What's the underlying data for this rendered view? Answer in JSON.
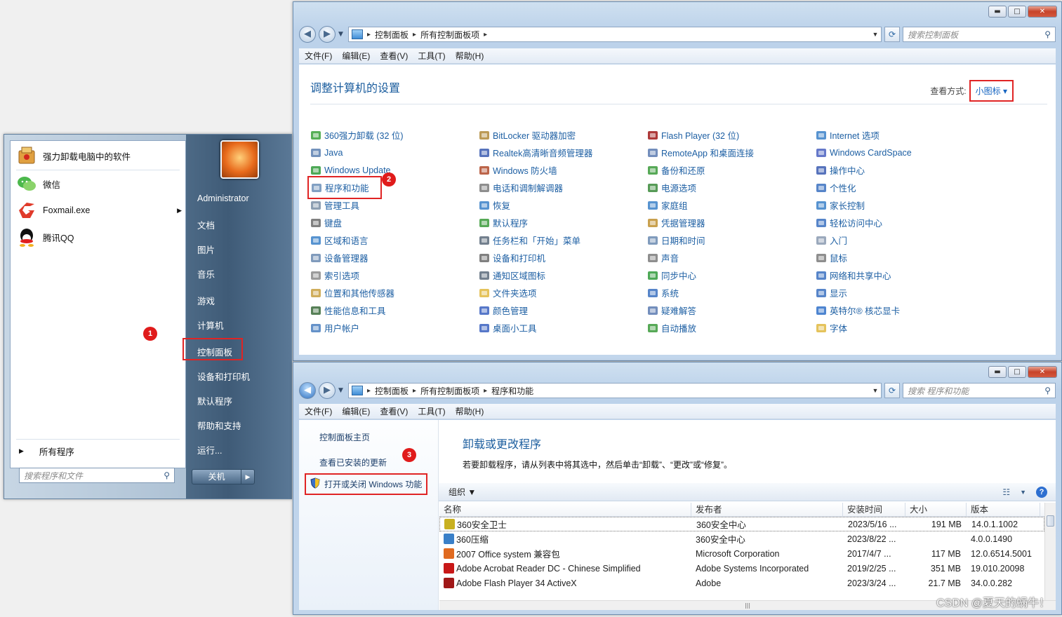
{
  "control_panel": {
    "breadcrumb": [
      "控制面板",
      "所有控制面板项"
    ],
    "search_placeholder": "搜索控制面板",
    "menu": [
      "文件(F)",
      "编辑(E)",
      "查看(V)",
      "工具(T)",
      "帮助(H)"
    ],
    "title": "调整计算机的设置",
    "view_by_label": "查看方式:",
    "view_by_value": "小图标",
    "items": [
      {
        "label": "360强力卸载 (32 位)",
        "icon": "uninstall-icon",
        "color": "#3aa13a"
      },
      {
        "label": "Java",
        "icon": "java-icon",
        "color": "#5a7fb0"
      },
      {
        "label": "Windows Update",
        "icon": "windows-update-icon",
        "color": "#2f9a3a"
      },
      {
        "label": "程序和功能",
        "icon": "programs-icon",
        "color": "#6b8fb8"
      },
      {
        "label": "管理工具",
        "icon": "admin-tools-icon",
        "color": "#7a8ea5"
      },
      {
        "label": "键盘",
        "icon": "keyboard-icon",
        "color": "#6a6a6a"
      },
      {
        "label": "区域和语言",
        "icon": "globe-icon",
        "color": "#3a80c8"
      },
      {
        "label": "设备管理器",
        "icon": "device-manager-icon",
        "color": "#6a8ab0"
      },
      {
        "label": "索引选项",
        "icon": "index-icon",
        "color": "#8a8a8a"
      },
      {
        "label": "位置和其他传感器",
        "icon": "sensor-icon",
        "color": "#c8a040"
      },
      {
        "label": "性能信息和工具",
        "icon": "performance-icon",
        "color": "#3a6a3a"
      },
      {
        "label": "用户帐户",
        "icon": "user-accounts-icon",
        "color": "#4a7fc0"
      },
      {
        "label": "BitLocker 驱动器加密",
        "icon": "bitlocker-icon",
        "color": "#b08a3a"
      },
      {
        "label": "Realtek高清晰音频管理器",
        "icon": "realtek-icon",
        "color": "#3a5ab0"
      },
      {
        "label": "Windows 防火墙",
        "icon": "firewall-icon",
        "color": "#b04a2a"
      },
      {
        "label": "电话和调制解调器",
        "icon": "phone-icon",
        "color": "#7a7a7a"
      },
      {
        "label": "恢复",
        "icon": "recovery-icon",
        "color": "#3a80c8"
      },
      {
        "label": "默认程序",
        "icon": "default-programs-icon",
        "color": "#3a9a3a"
      },
      {
        "label": "任务栏和「开始」菜单",
        "icon": "taskbar-icon",
        "color": "#5a6a7a"
      },
      {
        "label": "设备和打印机",
        "icon": "printer-icon",
        "color": "#6a6a6a"
      },
      {
        "label": "通知区域图标",
        "icon": "notification-icon",
        "color": "#5a6a7a"
      },
      {
        "label": "文件夹选项",
        "icon": "folder-options-icon",
        "color": "#e0b840"
      },
      {
        "label": "颜色管理",
        "icon": "color-management-icon",
        "color": "#3a60c0"
      },
      {
        "label": "桌面小工具",
        "icon": "gadgets-icon",
        "color": "#3a60c0"
      },
      {
        "label": "Flash Player (32 位)",
        "icon": "flash-icon",
        "color": "#a01818"
      },
      {
        "label": "RemoteApp 和桌面连接",
        "icon": "remoteapp-icon",
        "color": "#5a7ab0"
      },
      {
        "label": "备份和还原",
        "icon": "backup-icon",
        "color": "#3a9a3a"
      },
      {
        "label": "电源选项",
        "icon": "power-icon",
        "color": "#3a8a3a"
      },
      {
        "label": "家庭组",
        "icon": "homegroup-icon",
        "color": "#3a80c8"
      },
      {
        "label": "凭据管理器",
        "icon": "credential-icon",
        "color": "#c09030"
      },
      {
        "label": "日期和时间",
        "icon": "clock-icon",
        "color": "#6a8ab0"
      },
      {
        "label": "声音",
        "icon": "sound-icon",
        "color": "#7a7a7a"
      },
      {
        "label": "同步中心",
        "icon": "sync-icon",
        "color": "#2f9a3a"
      },
      {
        "label": "系统",
        "icon": "system-icon",
        "color": "#3a70c0"
      },
      {
        "label": "疑难解答",
        "icon": "troubleshoot-icon",
        "color": "#5a7ab0"
      },
      {
        "label": "自动播放",
        "icon": "autoplay-icon",
        "color": "#3a9a3a"
      },
      {
        "label": "Internet 选项",
        "icon": "internet-options-icon",
        "color": "#3a80c8"
      },
      {
        "label": "Windows CardSpace",
        "icon": "cardspace-icon",
        "color": "#4a60c0"
      },
      {
        "label": "操作中心",
        "icon": "flag-icon",
        "color": "#3a5ab0"
      },
      {
        "label": "个性化",
        "icon": "personalize-icon",
        "color": "#3a70c0"
      },
      {
        "label": "家长控制",
        "icon": "parental-icon",
        "color": "#3a80c8"
      },
      {
        "label": "轻松访问中心",
        "icon": "ease-of-access-icon",
        "color": "#3a70c0"
      },
      {
        "label": "入门",
        "icon": "getting-started-icon",
        "color": "#8a9ab0"
      },
      {
        "label": "鼠标",
        "icon": "mouse-icon",
        "color": "#7a7a7a"
      },
      {
        "label": "网络和共享中心",
        "icon": "network-icon",
        "color": "#3a70c0"
      },
      {
        "label": "显示",
        "icon": "display-icon",
        "color": "#3a70c0"
      },
      {
        "label": "英特尔® 核芯显卡",
        "icon": "intel-graphics-icon",
        "color": "#2f70c8"
      },
      {
        "label": "字体",
        "icon": "fonts-icon",
        "color": "#e0b840"
      }
    ]
  },
  "start_menu": {
    "pinned": [
      {
        "label": "强力卸载电脑中的软件",
        "icon": "uninstall-box-icon",
        "color": "#e0a040"
      },
      {
        "label": "微信",
        "icon": "wechat-icon",
        "color": "#4cb84c"
      },
      {
        "label": "Foxmail.exe",
        "icon": "foxmail-icon",
        "color": "#e03a2a"
      },
      {
        "label": "腾讯QQ",
        "icon": "qq-icon",
        "color": "#111111"
      }
    ],
    "foxmail_arrow": "▶",
    "all_programs": "所有程序",
    "search_placeholder": "搜索程序和文件",
    "right_items": [
      "Administrator",
      "文档",
      "图片",
      "音乐",
      "游戏",
      "计算机",
      "控制面板",
      "设备和打印机",
      "默认程序",
      "帮助和支持",
      "运行..."
    ],
    "shutdown": "关机"
  },
  "programs": {
    "breadcrumb": [
      "控制面板",
      "所有控制面板项",
      "程序和功能"
    ],
    "search_placeholder": "搜索 程序和功能",
    "menu": [
      "文件(F)",
      "编辑(E)",
      "查看(V)",
      "工具(T)",
      "帮助(H)"
    ],
    "side_links": [
      "控制面板主页",
      "查看已安装的更新",
      "打开或关闭 Windows 功能"
    ],
    "title": "卸载或更改程序",
    "description": "若要卸载程序，请从列表中将其选中，然后单击“卸载”、“更改”或“修复”。",
    "organize": "组织 ▼",
    "columns": [
      "名称",
      "发布者",
      "安装时间",
      "大小",
      "版本"
    ],
    "rows": [
      {
        "name": "360安全卫士",
        "publisher": "360安全中心",
        "date": "2023/5/16 ...",
        "size": "191 MB",
        "version": "14.0.1.1002",
        "color": "#c8b020"
      },
      {
        "name": "360压缩",
        "publisher": "360安全中心",
        "date": "2023/8/22 ...",
        "size": "",
        "version": "4.0.0.1490",
        "color": "#3a80c8"
      },
      {
        "name": "2007 Office system 兼容包",
        "publisher": "Microsoft Corporation",
        "date": "2017/4/7 ...",
        "size": "117 MB",
        "version": "12.0.6514.5001",
        "color": "#e06a20"
      },
      {
        "name": "Adobe Acrobat Reader DC - Chinese Simplified",
        "publisher": "Adobe Systems Incorporated",
        "date": "2019/2/25 ...",
        "size": "351 MB",
        "version": "19.010.20098",
        "color": "#c81818"
      },
      {
        "name": "Adobe Flash Player 34 ActiveX",
        "publisher": "Adobe",
        "date": "2023/3/24 ...",
        "size": "21.7 MB",
        "version": "34.0.0.282",
        "color": "#a01818"
      }
    ]
  },
  "badges": [
    "1",
    "2",
    "3"
  ],
  "watermark": "CSDN @夏天的蜗牛！"
}
